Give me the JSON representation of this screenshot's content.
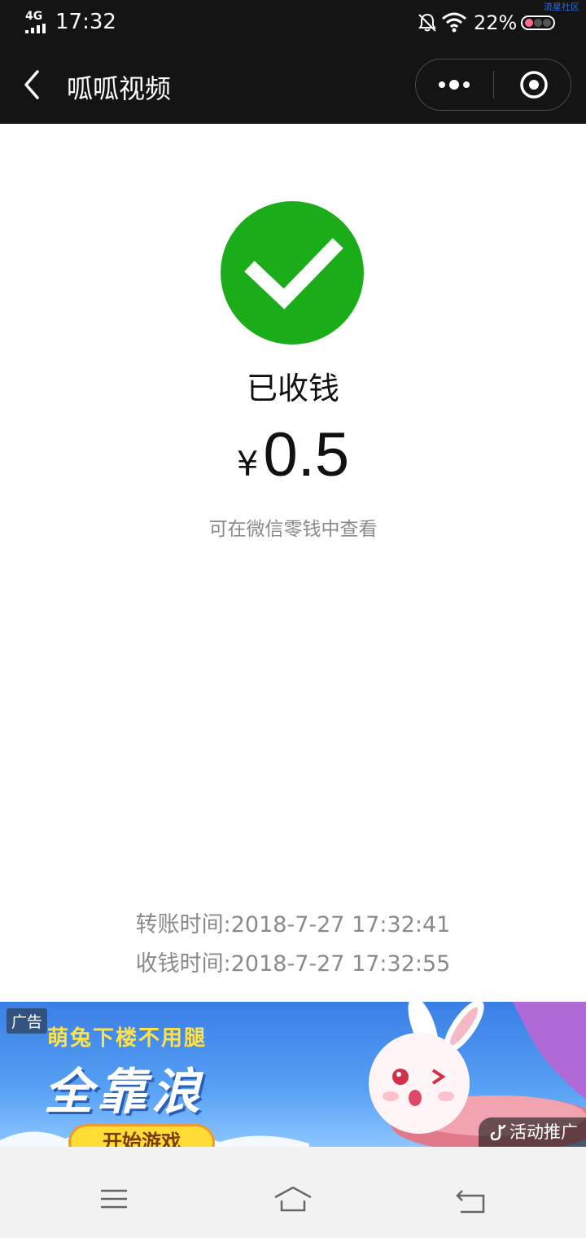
{
  "status_bar": {
    "network": "4G",
    "time": "17:32",
    "battery": "22%",
    "icons": [
      "signal-icon",
      "mute-bell-icon",
      "wifi-icon",
      "battery-icon"
    ]
  },
  "watermark": "流星社区",
  "nav": {
    "title": "呱呱视频",
    "back_icon": "back-chevron-icon",
    "more_icon": "more-dots-icon",
    "close_icon": "target-close-icon"
  },
  "result": {
    "status": "已收钱",
    "currency": "¥",
    "amount": "0.5",
    "hint": "可在微信零钱中查看",
    "accent_color": "#1aad19"
  },
  "times": {
    "transfer": "转账时间:2018-7-27 17:32:41",
    "receive": "收钱时间:2018-7-27 17:32:55"
  },
  "ad": {
    "tag": "广告",
    "subtitle": "萌兔下楼不用腿",
    "title": "全靠浪",
    "button": "开始游戏",
    "promo": "活动推广"
  },
  "system_nav": {
    "icons": [
      "menu-icon",
      "home-icon",
      "back-icon"
    ]
  }
}
